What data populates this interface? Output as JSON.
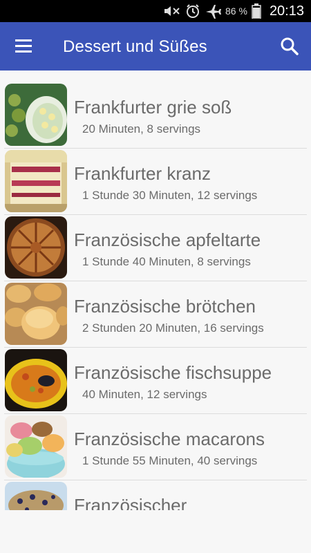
{
  "status_bar": {
    "battery_percent": "86 %",
    "time": "20:13",
    "icons": [
      "mute-icon",
      "alarm-icon",
      "airplane-icon",
      "battery-icon"
    ]
  },
  "app_bar": {
    "title": "Dessert und Süßes",
    "menu_icon": "hamburger-menu-icon",
    "search_icon": "search-icon",
    "color": "#3b54b8"
  },
  "recipes": [
    {
      "title": "Frankfurter grie soß",
      "subtitle": "20 Minuten, 8 servings"
    },
    {
      "title": "Frankfurter kranz",
      "subtitle": "1 Stunde 30 Minuten, 12 servings"
    },
    {
      "title": "Französische apfeltarte",
      "subtitle": "1 Stunde 40 Minuten, 8 servings"
    },
    {
      "title": "Französische brötchen",
      "subtitle": "2 Stunden 20 Minuten, 16 servings"
    },
    {
      "title": "Französische fischsuppe",
      "subtitle": "40 Minuten, 12 servings"
    },
    {
      "title": "Französische macarons",
      "subtitle": "1 Stunde 55 Minuten, 40 servings"
    },
    {
      "title": "Französischer",
      "subtitle": ""
    }
  ]
}
